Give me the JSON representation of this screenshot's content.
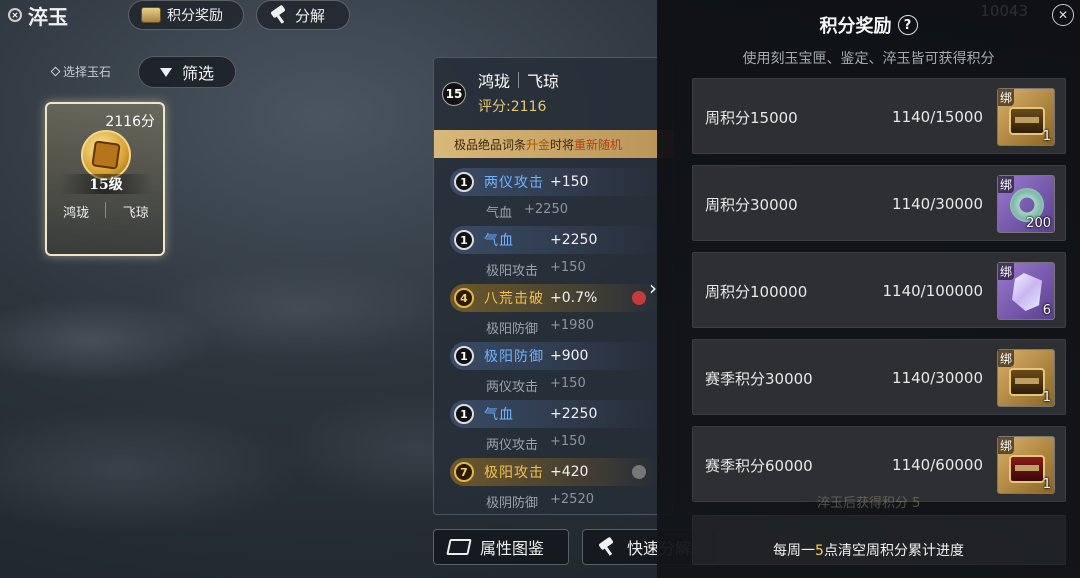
{
  "header": {
    "title": "淬玉",
    "reward_button": "积分奖励",
    "decompose_button": "分解"
  },
  "filter": {
    "select_label": "选择玉石",
    "filter_button": "筛选"
  },
  "jade_card": {
    "score": "2116分",
    "level": "15级",
    "tag_left": "鸿珑",
    "tag_right": "飞琼"
  },
  "detail": {
    "level": "15",
    "name_left": "鸿珑",
    "name_right": "飞琼",
    "score": "评分:2116",
    "notice_pre": "极品绝品词条",
    "notice_hl1": "升金",
    "notice_mid": "时将",
    "notice_hl2": "重新随机",
    "attributes": [
      {
        "num": "1",
        "name": "两仪攻击",
        "value": "+150",
        "sub_name": "气血",
        "sub_value": "+2250",
        "tier": "blue"
      },
      {
        "num": "1",
        "name": "气血",
        "value": "+2250",
        "sub_name": "极阳攻击",
        "sub_value": "+150",
        "tier": "blue"
      },
      {
        "num": "4",
        "name": "八荒击破",
        "value": "+0.7%",
        "sub_name": "极阳防御",
        "sub_value": "+1980",
        "tier": "gold"
      },
      {
        "num": "1",
        "name": "极阳防御",
        "value": "+900",
        "sub_name": "两仪攻击",
        "sub_value": "+150",
        "tier": "blue"
      },
      {
        "num": "1",
        "name": "气血",
        "value": "+2250",
        "sub_name": "两仪攻击",
        "sub_value": "+150",
        "tier": "blue"
      },
      {
        "num": "7",
        "name": "极阳攻击",
        "value": "+420",
        "sub_name": "极阴防御",
        "sub_value": "+2520",
        "tier": "gold"
      }
    ]
  },
  "bottom": {
    "atlas_button": "属性图鉴",
    "quick_button": "快速分解"
  },
  "reward_panel": {
    "title": "积分奖励",
    "help": "?",
    "subtitle": "使用刻玉宝匣、鉴定、淬玉皆可获得积分",
    "ghost_number": "10043",
    "items": [
      {
        "name": "周积分15000",
        "progress": "1140/15000",
        "bind": "绑",
        "qty": "1",
        "icon": "treasure-chest-icon"
      },
      {
        "name": "周积分30000",
        "progress": "1140/30000",
        "bind": "绑",
        "qty": "200",
        "icon": "jade-ring-icon"
      },
      {
        "name": "周积分100000",
        "progress": "1140/100000",
        "bind": "绑",
        "qty": "6",
        "icon": "crystal-icon"
      },
      {
        "name": "赛季积分30000",
        "progress": "1140/30000",
        "bind": "绑",
        "qty": "1",
        "icon": "treasure-chest-icon"
      },
      {
        "name": "赛季积分60000",
        "progress": "1140/60000",
        "bind": "绑",
        "qty": "1",
        "icon": "treasure-chest-icon"
      }
    ],
    "hint": "淬玉后获得积分",
    "hint_value": "5",
    "footer_pre": "每周一",
    "footer_hl": "5",
    "footer_post": "点清空周积分累计进度"
  },
  "colors": {
    "blue_attr": "#6fb3ff",
    "gold_attr": "#f0c050",
    "score_gold": "#e8c870",
    "footer_highlight": "#ffd24a"
  }
}
